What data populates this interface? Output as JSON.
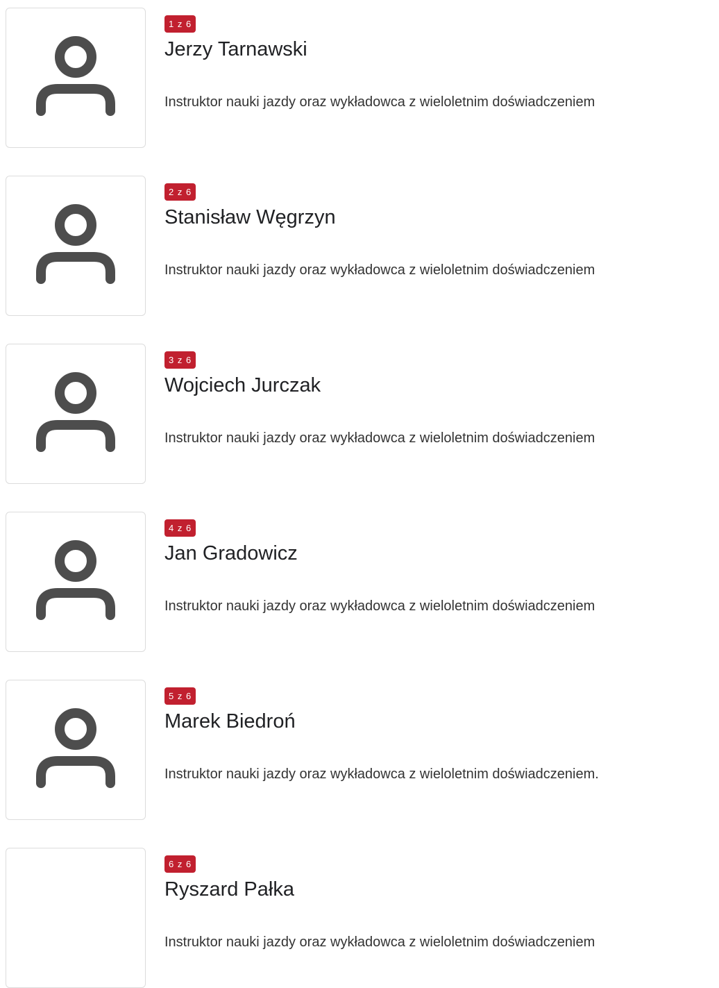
{
  "instructors": [
    {
      "counter": "1 z 6",
      "name": "Jerzy Tarnawski",
      "description": "Instruktor nauki jazdy oraz wykładowca z wieloletnim doświadczeniem",
      "avatar_icon": "person-icon"
    },
    {
      "counter": "2 z 6",
      "name": "Stanisław Węgrzyn",
      "description": "Instruktor nauki jazdy oraz wykładowca z wieloletnim doświadczeniem",
      "avatar_icon": "person-icon"
    },
    {
      "counter": "3 z 6",
      "name": "Wojciech Jurczak",
      "description": "Instruktor nauki jazdy oraz wykładowca z wieloletnim doświadczeniem",
      "avatar_icon": "person-icon"
    },
    {
      "counter": "4 z 6",
      "name": "Jan Gradowicz",
      "description": "Instruktor nauki jazdy oraz wykładowca z wieloletnim doświadczeniem",
      "avatar_icon": "person-icon"
    },
    {
      "counter": "5 z 6",
      "name": "Marek Biedroń",
      "description": "Instruktor nauki jazdy oraz wykładowca z wieloletnim doświadczeniem.",
      "avatar_icon": "person-icon"
    },
    {
      "counter": "6 z 6",
      "name": "Ryszard Pałka",
      "description": "Instruktor nauki jazdy oraz wykładowca z wieloletnim doświadczeniem",
      "avatar_icon": ""
    }
  ],
  "colors": {
    "badge_background": "#c1202f",
    "icon_stroke": "#4d4d4d",
    "border": "#dcdcdc"
  }
}
